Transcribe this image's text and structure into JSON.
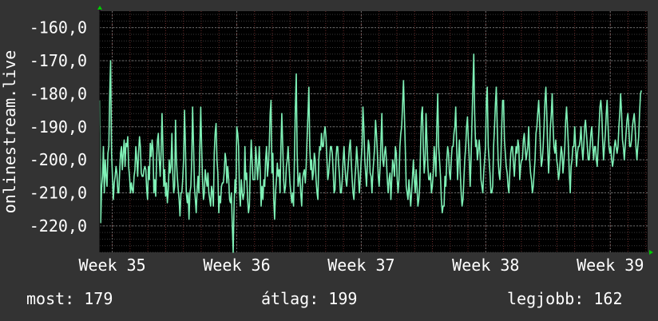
{
  "colors": {
    "background": "#333333",
    "plot_background": "#000000",
    "line": "#7ff0b6",
    "grid_major": "#6a6a6a",
    "grid_minor_vertical": "#6a2a2a",
    "axis_marker": "#00cc00",
    "text": "#ffffff"
  },
  "stats": {
    "now_label": "most:",
    "now_value": "179",
    "avg_label": "átlag:",
    "avg_value": "199",
    "best_label": "legjobb:",
    "best_value": "162"
  },
  "chart_data": {
    "type": "line",
    "title": "",
    "xlabel": "",
    "ylabel": "onlinestream.live",
    "y_tick_labels": [
      "-160,0",
      "-170,0",
      "-180,0",
      "-190,0",
      "-200,0",
      "-210,0",
      "-220,0"
    ],
    "y_ticks": [
      -160,
      -170,
      -180,
      -190,
      -200,
      -210,
      -220
    ],
    "ylim": [
      -228,
      -155
    ],
    "x_tick_labels": [
      "Week 35",
      "Week 36",
      "Week 37",
      "Week 38",
      "Week 39"
    ],
    "x_ticks": [
      35,
      36,
      37,
      38,
      39
    ],
    "xlim": [
      34.9,
      39.3
    ],
    "grid": true,
    "legend": "none",
    "series": [
      {
        "x_start": 34.9,
        "x_end": 39.25,
        "values": [
          -182,
          -219,
          -208,
          -205,
          -196,
          -210,
          -200,
          -205,
          -208,
          -198,
          -196,
          -180,
          -170,
          -198,
          -205,
          -212,
          -207,
          -205,
          -202,
          -204,
          -210,
          -210,
          -204,
          -198,
          -196,
          -203,
          -198,
          -194,
          -202,
          -195,
          -196,
          -193,
          -202,
          -205,
          -210,
          -207,
          -209,
          -210,
          -205,
          -203,
          -196,
          -200,
          -205,
          -198,
          -193,
          -196,
          -204,
          -205,
          -205,
          -203,
          -202,
          -203,
          -209,
          -212,
          -202,
          -206,
          -195,
          -199,
          -194,
          -197,
          -210,
          -206,
          -211,
          -200,
          -194,
          -192,
          -200,
          -205,
          -198,
          -186,
          -196,
          -208,
          -203,
          -211,
          -207,
          -213,
          -209,
          -200,
          -204,
          -202,
          -192,
          -204,
          -210,
          -208,
          -188,
          -200,
          -205,
          -209,
          -212,
          -217,
          -210,
          -210,
          -206,
          -200,
          -185,
          -196,
          -210,
          -213,
          -210,
          -218,
          -210,
          -208,
          -200,
          -184,
          -196,
          -208,
          -212,
          -216,
          -209,
          -205,
          -210,
          -196,
          -184,
          -196,
          -206,
          -212,
          -210,
          -203,
          -206,
          -208,
          -204,
          -210,
          -212,
          -214,
          -208,
          -210,
          -214,
          -198,
          -192,
          -189,
          -200,
          -204,
          -216,
          -211,
          -213,
          -208,
          -207,
          -207,
          -204,
          -198,
          -200,
          -207,
          -202,
          -206,
          -212,
          -213,
          -210,
          -220,
          -228,
          -214,
          -206,
          -210,
          -190,
          -192,
          -196,
          -210,
          -214,
          -206,
          -210,
          -212,
          -210,
          -196,
          -206,
          -204,
          -212,
          -216,
          -214,
          -202,
          -194,
          -200,
          -206,
          -206,
          -206,
          -196,
          -200,
          -206,
          -202,
          -196,
          -204,
          -214,
          -208,
          -212,
          -206,
          -208,
          -200,
          -196,
          -205,
          -202,
          -196,
          -186,
          -182,
          -204,
          -198,
          -212,
          -218,
          -210,
          -206,
          -201,
          -205,
          -203,
          -210,
          -196,
          -186,
          -196,
          -206,
          -210,
          -208,
          -202,
          -200,
          -196,
          -202,
          -207,
          -210,
          -213,
          -210,
          -214,
          -200,
          -184,
          -174,
          -198,
          -208,
          -206,
          -204,
          -210,
          -214,
          -206,
          -204,
          -203,
          -207,
          -202,
          -194,
          -186,
          -178,
          -196,
          -203,
          -200,
          -206,
          -204,
          -198,
          -200,
          -206,
          -210,
          -212,
          -200,
          -196,
          -197,
          -192,
          -196,
          -196,
          -192,
          -190,
          -193,
          -200,
          -206,
          -204,
          -200,
          -196,
          -196,
          -198,
          -204,
          -210,
          -209,
          -200,
          -196,
          -196,
          -201,
          -205,
          -210,
          -210,
          -206,
          -200,
          -196,
          -202,
          -206,
          -208,
          -204,
          -200,
          -196,
          -194,
          -200,
          -206,
          -210,
          -212,
          -206,
          -202,
          -196,
          -200,
          -205,
          -210,
          -206,
          -200,
          -196,
          -184,
          -190,
          -200,
          -204,
          -208,
          -200,
          -194,
          -196,
          -204,
          -205,
          -210,
          -204,
          -200,
          -196,
          -188,
          -192,
          -198,
          -205,
          -208,
          -202,
          -194,
          -186,
          -200,
          -202,
          -198,
          -196,
          -200,
          -206,
          -210,
          -206,
          -204,
          -212,
          -206,
          -200,
          -202,
          -205,
          -196,
          -198,
          -206,
          -210,
          -206,
          -196,
          -192,
          -190,
          -183,
          -176,
          -186,
          -196,
          -208,
          -210,
          -212,
          -206,
          -210,
          -214,
          -210,
          -205,
          -200,
          -206,
          -210,
          -203,
          -208,
          -214,
          -212,
          -208,
          -196,
          -186,
          -184,
          -196,
          -204,
          -200,
          -186,
          -194,
          -202,
          -206,
          -206,
          -204,
          -210,
          -208,
          -204,
          -196,
          -200,
          -205,
          -190,
          -180,
          -196,
          -200,
          -205,
          -212,
          -216,
          -214,
          -214,
          -205,
          -208,
          -200,
          -196,
          -198,
          -204,
          -206,
          -200,
          -196,
          -196,
          -192,
          -190,
          -184,
          -196,
          -206,
          -200,
          -194,
          -204,
          -210,
          -214,
          -212,
          -206,
          -200,
          -196,
          -190,
          -187,
          -194,
          -200,
          -208,
          -200,
          -188,
          -178,
          -168,
          -186,
          -196,
          -194,
          -200,
          -197,
          -194,
          -198,
          -206,
          -208,
          -210,
          -204,
          -200,
          -196,
          -182,
          -178,
          -196,
          -200,
          -204,
          -210,
          -210,
          -208,
          -196,
          -190,
          -183,
          -178,
          -190,
          -200,
          -204,
          -206,
          -200,
          -190,
          -182,
          -182,
          -194,
          -198,
          -202,
          -204,
          -208,
          -210,
          -204,
          -198,
          -196,
          -196,
          -201,
          -205,
          -200,
          -196,
          -198,
          -194,
          -196,
          -206,
          -202,
          -200,
          -200,
          -194,
          -192,
          -196,
          -200,
          -198,
          -196,
          -190,
          -200,
          -204,
          -206,
          -210,
          -208,
          -204,
          -200,
          -192,
          -190,
          -186,
          -182,
          -188,
          -196,
          -202,
          -200,
          -196,
          -190,
          -182,
          -178,
          -186,
          -196,
          -204,
          -198,
          -190,
          -186,
          -180,
          -190,
          -196,
          -198,
          -194,
          -200,
          -202,
          -206,
          -204,
          -200,
          -196,
          -198,
          -204,
          -200,
          -196,
          -188,
          -184,
          -190,
          -196,
          -204,
          -210,
          -202,
          -200,
          -196,
          -196,
          -190,
          -196,
          -202,
          -198,
          -196,
          -196,
          -194,
          -190,
          -196,
          -200,
          -196,
          -190,
          -188,
          -192,
          -196,
          -200,
          -200,
          -196,
          -192,
          -190,
          -196,
          -200,
          -196,
          -196,
          -200,
          -202,
          -196,
          -190,
          -184,
          -182,
          -186,
          -194,
          -200,
          -196,
          -192,
          -186,
          -182,
          -190,
          -196,
          -198,
          -196,
          -200,
          -202,
          -200,
          -196,
          -194,
          -196,
          -198,
          -196,
          -190,
          -186,
          -180,
          -186,
          -194,
          -196,
          -200,
          -196,
          -192,
          -188,
          -186,
          -190,
          -196,
          -196,
          -194,
          -190,
          -188,
          -186,
          -190,
          -196,
          -200,
          -196,
          -193,
          -186,
          -180,
          -179
        ]
      }
    ]
  }
}
